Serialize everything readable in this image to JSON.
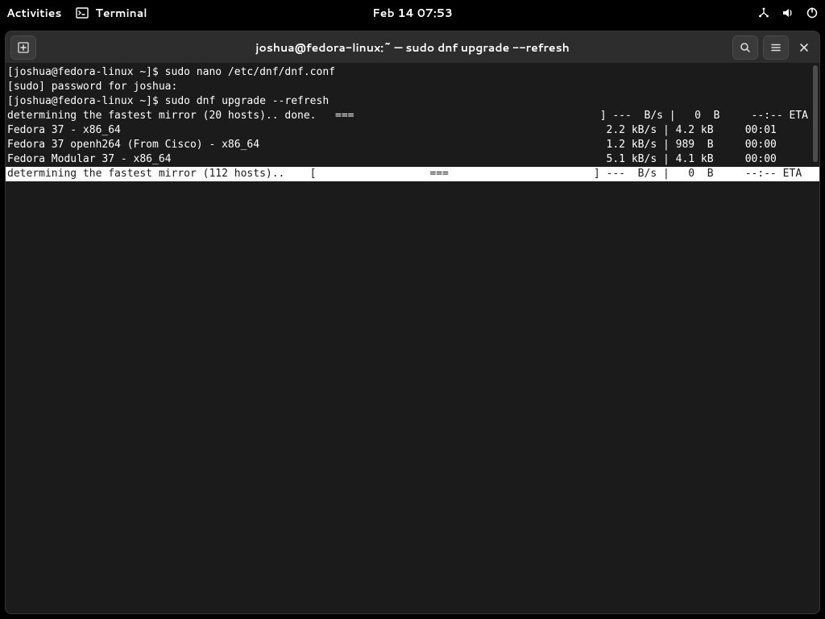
{
  "topbar": {
    "activities": "Activities",
    "app_name": "Terminal",
    "datetime": "Feb 14  07:53"
  },
  "window": {
    "title": "joshua@fedora-linux:~ — sudo dnf upgrade --refresh"
  },
  "terminal": {
    "lines": [
      {
        "text": "[joshua@fedora-linux ~]$ sudo nano /etc/dnf/dnf.conf",
        "inverse": false
      },
      {
        "text": "[sudo] password for joshua:",
        "inverse": false
      },
      {
        "text": "[joshua@fedora-linux ~]$ sudo dnf upgrade --refresh",
        "inverse": false
      },
      {
        "text": "determining the fastest mirror (20 hosts).. done.   ===                                       ] ---  B/s |   0  B     --:-- ETA",
        "inverse": false
      },
      {
        "text": "Fedora 37 - x86_64                                                                             2.2 kB/s | 4.2 kB     00:01",
        "inverse": false
      },
      {
        "text": "Fedora 37 openh264 (From Cisco) - x86_64                                                       1.2 kB/s | 989  B     00:00",
        "inverse": false
      },
      {
        "text": "Fedora Modular 37 - x86_64                                                                     5.1 kB/s | 4.1 kB     00:00",
        "inverse": false
      },
      {
        "text": "determining the fastest mirror (112 hosts)..    [                  ===                       ] ---  B/s |   0  B     --:-- ETA",
        "inverse": true
      }
    ]
  }
}
